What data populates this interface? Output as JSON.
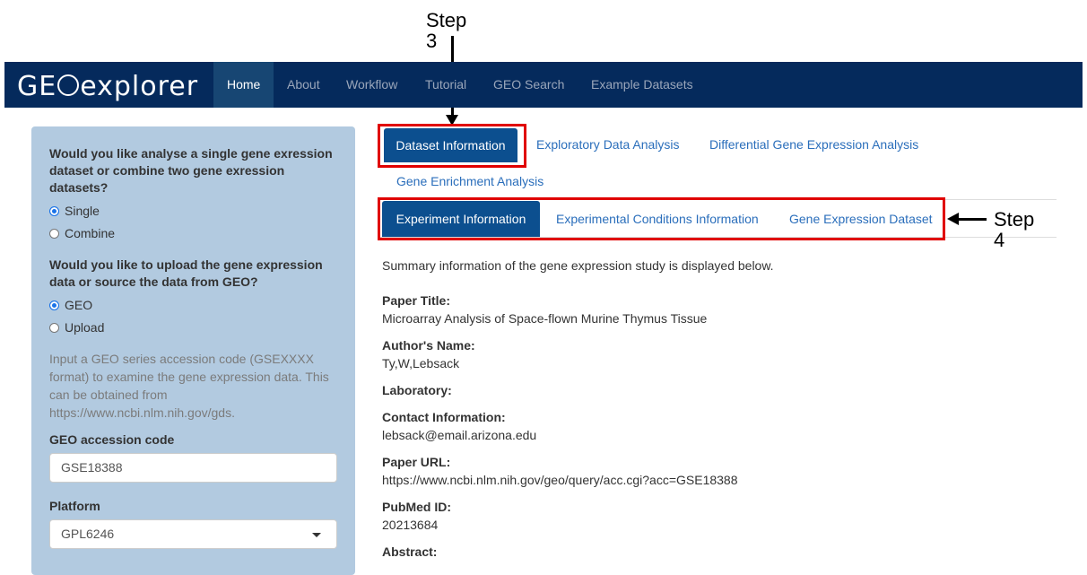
{
  "annotations": {
    "step3_line1": "Step",
    "step3_line2": "3",
    "step4_line1": "Step",
    "step4_line2": "4"
  },
  "navbar": {
    "brand_left": "GE",
    "brand_right": "explorer",
    "items": [
      "Home",
      "About",
      "Workflow",
      "Tutorial",
      "GEO Search",
      "Example Datasets"
    ],
    "active": "Home",
    "bg_color": "#052a5c"
  },
  "sidebar": {
    "q1": "Would you like analyse a single gene exression dataset or combine two gene exression datasets?",
    "q1_options": [
      "Single",
      "Combine"
    ],
    "q1_selected": "Single",
    "q2": "Would you like to upload the gene expression data or source the data from GEO?",
    "q2_options": [
      "GEO",
      "Upload"
    ],
    "q2_selected": "GEO",
    "help_text": "Input a GEO series accession code (GSEXXXX format) to examine the gene expression data. This can be obtained from https://www.ncbi.nlm.nih.gov/gds.",
    "accession_label": "GEO accession code",
    "accession_value": "GSE18388",
    "platform_label": "Platform",
    "platform_value": "GPL6246"
  },
  "main_tabs": {
    "active": "Dataset Information",
    "others": [
      "Exploratory Data Analysis",
      "Differential Gene Expression Analysis",
      "Gene Enrichment Analysis"
    ]
  },
  "sub_tabs": {
    "active": "Experiment Information",
    "others": [
      "Experimental Conditions Information",
      "Gene Expression Dataset"
    ]
  },
  "content": {
    "summary": "Summary information of the gene expression study is displayed below.",
    "paper_title_label": "Paper Title:",
    "paper_title": "Microarray Analysis of Space-flown Murine Thymus Tissue",
    "author_label": "Author's Name:",
    "author": "Ty,W,Lebsack",
    "lab_label": "Laboratory:",
    "contact_label": "Contact Information:",
    "contact": "lebsack@email.arizona.edu",
    "url_label": "Paper URL:",
    "url": "https://www.ncbi.nlm.nih.gov/geo/query/acc.cgi?acc=GSE18388",
    "pubmed_label": "PubMed ID:",
    "pubmed": "20213684",
    "abstract_label": "Abstract:"
  },
  "colors": {
    "highlight": "#e00000",
    "tab_active": "#0c4f8f",
    "sidebar_bg": "#b2cae0",
    "link": "#2a6ebb"
  }
}
